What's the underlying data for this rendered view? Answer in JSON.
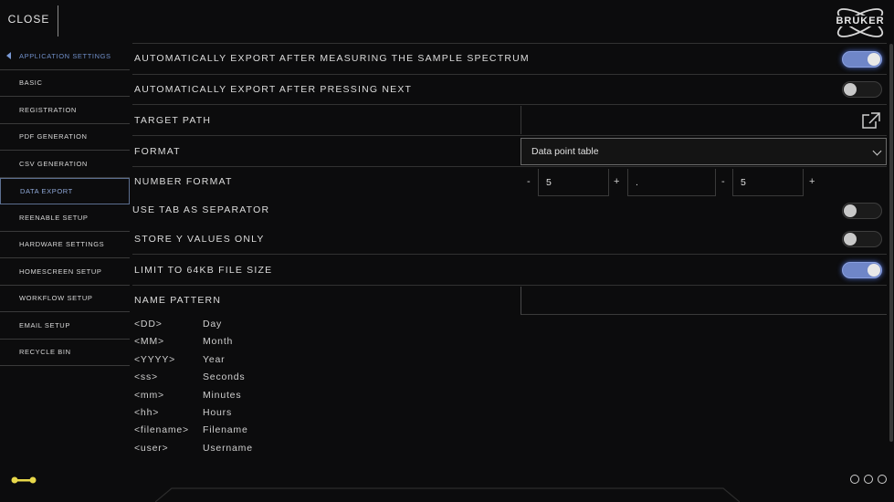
{
  "header": {
    "close_label": "CLOSE",
    "logo_text": "BRUKER"
  },
  "sidebar": {
    "items": [
      {
        "label": "APPLICATION SETTINGS",
        "state": "parent"
      },
      {
        "label": "BASIC"
      },
      {
        "label": "REGISTRATION"
      },
      {
        "label": "PDF GENERATION"
      },
      {
        "label": "CSV GENERATION"
      },
      {
        "label": "DATA EXPORT",
        "state": "active"
      },
      {
        "label": "REENABLE SETUP"
      },
      {
        "label": "HARDWARE SETTINGS"
      },
      {
        "label": "HOMESCREEN SETUP"
      },
      {
        "label": "WORKFLOW SETUP"
      },
      {
        "label": "EMAIL SETUP"
      },
      {
        "label": "RECYCLE BIN"
      }
    ]
  },
  "settings": {
    "auto_export_sample": {
      "label": "AUTOMATICALLY EXPORT AFTER MEASURING THE SAMPLE SPECTRUM",
      "on": true
    },
    "auto_export_next": {
      "label": "AUTOMATICALLY EXPORT AFTER PRESSING NEXT",
      "on": false
    },
    "target_path": {
      "label": "TARGET PATH",
      "value": ""
    },
    "format": {
      "label": "FORMAT",
      "value": "Data point table"
    },
    "number_format": {
      "label": "NUMBER FORMAT",
      "minus": "-",
      "plus": "+",
      "integer_digits": "5",
      "decimal_separator": ".",
      "decimal_digits": "5"
    },
    "tab_separator": {
      "label": "USE TAB AS SEPARATOR",
      "on": false
    },
    "store_y_only": {
      "label": "STORE Y VALUES ONLY",
      "on": false
    },
    "limit_64kb": {
      "label": "LIMIT TO 64KB FILE SIZE",
      "on": true
    },
    "name_pattern": {
      "label": "NAME PATTERN",
      "value": ""
    }
  },
  "pattern_legend": [
    {
      "token": "<DD>",
      "meaning": "Day"
    },
    {
      "token": "<MM>",
      "meaning": "Month"
    },
    {
      "token": "<YYYY>",
      "meaning": "Year"
    },
    {
      "token": "<ss>",
      "meaning": "Seconds"
    },
    {
      "token": "<mm>",
      "meaning": "Minutes"
    },
    {
      "token": "<hh>",
      "meaning": "Hours"
    },
    {
      "token": "<filename>",
      "meaning": "Filename"
    },
    {
      "token": "<user>",
      "meaning": "Username"
    }
  ],
  "colors": {
    "accent": "#6f86c8",
    "background": "#0c0c0d"
  },
  "icons": {
    "back": "caret-left-icon",
    "external": "external-link-icon",
    "key": "key-icon",
    "pager": "page-dots-icon"
  }
}
